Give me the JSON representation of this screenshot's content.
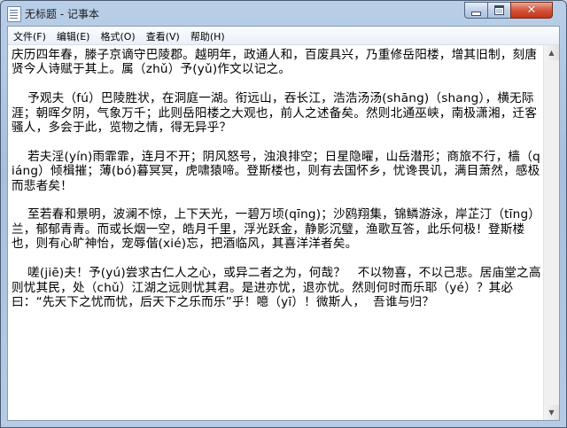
{
  "window": {
    "title": "无标题 - 记事本",
    "minimize_icon": "minimize-icon",
    "maximize_icon": "maximize-icon",
    "close_icon": "close-icon",
    "close_glyph": "✕"
  },
  "menu": [
    {
      "label": "文件(F)"
    },
    {
      "label": "编辑(E)"
    },
    {
      "label": "格式(O)"
    },
    {
      "label": "查看(V)"
    },
    {
      "label": "帮助(H)"
    }
  ],
  "editor": {
    "text": "庆历四年春，滕子京谪守巴陵郡。越明年，政通人和，百废具兴，乃重修岳阳楼，增其旧制，刻唐贤今人诗赋于其上。属（zhǔ）予(yǔ)作文以记之。\n\n    予观夫（fú）巴陵胜状，在洞庭一湖。衔远山，吞长江，浩浩汤汤(shāng)（shang），横无际涯；朝晖夕阴，气象万千；此则岳阳楼之大观也，前人之述备矣。然则北通巫峡，南极潇湘，迁客骚人，多会于此，览物之情，得无异乎？\n\n    若夫淫(yín)雨霏霏，连月不开；阴风怒号，浊浪排空；日星隐曜，山岳潜形；商旅不行，樯（qiáng）倾楫摧；薄(bó)暮冥冥，虎啸猿啼。登斯楼也，则有去国怀乡，忧谗畏讥，满目萧然，感极而悲者矣！\n\n    至若春和景明，波澜不惊，上下天光，一碧万顷(qīng)；沙鸥翔集，锦鳞游泳，岸芷汀（tīng）兰，郁郁青青。而或长烟一空，皓月千里，浮光跃金，静影沉璧，渔歌互答，此乐何极！登斯楼也，则有心旷神怡，宠辱偕(xié)忘，把酒临风，其喜洋洋者矣。\n\n    嗟(jiē)夫！予(yú)尝求古仁人之心，或异二者之为，何哉？   不以物喜，不以己悲。居庙堂之高则忧其民，处（chǔ）江湖之远则忧其君。是进亦忧，退亦忧。然则何时而乐耶（yé）？其必曰：“先天下之忧而忧，后天下之乐而乐”乎！噫（yī）！微斯人，  吾谁与归？"
  }
}
